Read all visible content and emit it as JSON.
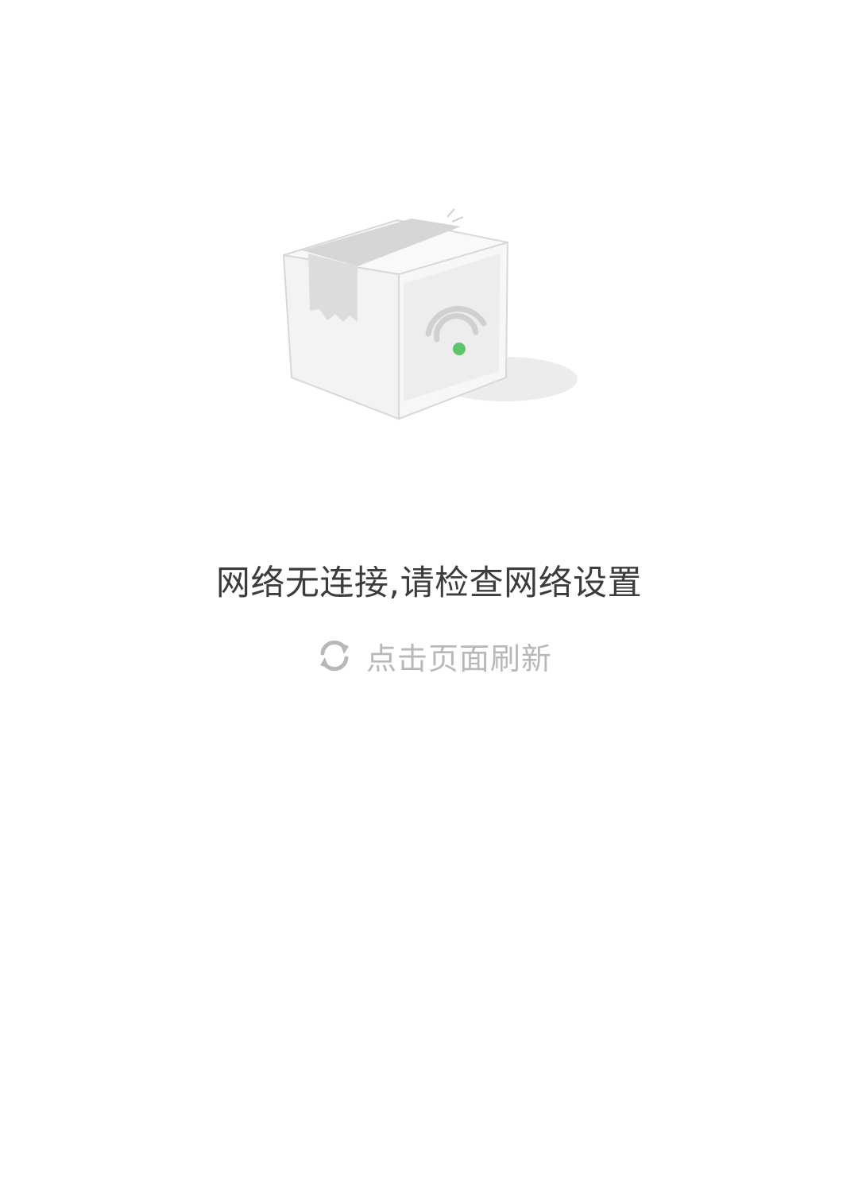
{
  "empty_state": {
    "illustration": "box-wifi-illustration",
    "message": "网络无连接,请检查网络设置",
    "refresh_label": "点击页面刷新",
    "refresh_icon": "refresh-icon"
  },
  "colors": {
    "background": "#ffffff",
    "message_text": "#3c3c3c",
    "refresh_text": "#b8b8b8",
    "wifi_dot": "#5cc46a"
  }
}
